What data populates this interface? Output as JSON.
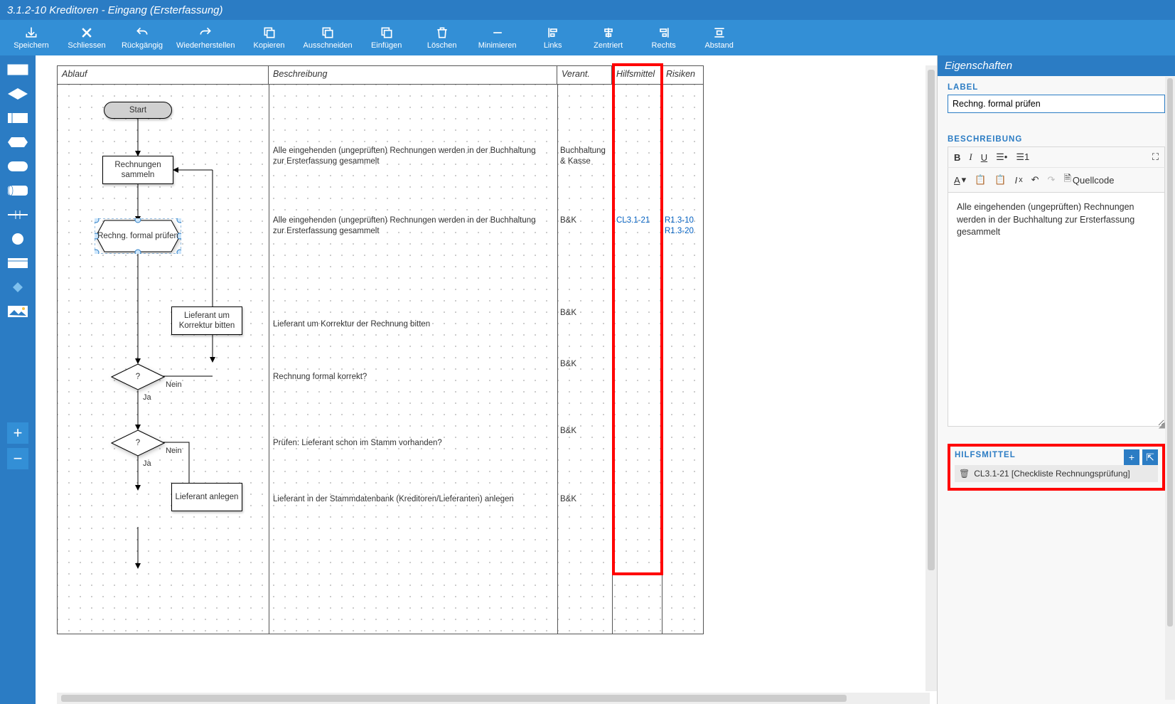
{
  "title": "3.1.2-10 Kreditoren - Eingang (Ersterfassung)",
  "toolbar": {
    "save": "Speichern",
    "close": "Schliessen",
    "undo": "Rückgängig",
    "redo": "Wiederherstellen",
    "copy": "Kopieren",
    "cut": "Ausschneiden",
    "paste": "Einfügen",
    "delete": "Löschen",
    "minimize": "Minimieren",
    "alignLeft": "Links",
    "alignCenter": "Zentriert",
    "alignRight": "Rechts",
    "spacing": "Abstand"
  },
  "swimlanes": {
    "ablauf": "Ablauf",
    "beschreibung": "Beschreibung",
    "verant": "Verant.",
    "hilfsmittel": "Hilfsmittel",
    "risiken": "Risiken"
  },
  "nodes": {
    "start": "Start",
    "n1": "Rechnungen sammeln",
    "n2": "Rechng. formal prüfen",
    "n3": "Lieferant um Korrektur bitten",
    "d1": "?",
    "d2": "?",
    "n4": "Lieferant anlegen",
    "ja": "Ja",
    "nein": "Nein"
  },
  "rows": {
    "r1": {
      "desc": "Alle eingehenden (ungeprüften) Rechnungen werden in der Buchhaltung zur Ersterfassung gesammelt",
      "verant": "Buchhaltung & Kasse"
    },
    "r2": {
      "desc": "Alle eingehenden (ungeprüften) Rechnungen werden in der Buchhaltung zur Ersterfassung gesammelt",
      "verant": "B&K",
      "hilfs": "CL3.1-21",
      "risk1": "R1.3-10",
      "risk2": "R1.3-20"
    },
    "r3": {
      "desc": "Lieferant um Korrektur der Rechnung bitten",
      "verant": "B&K"
    },
    "r4": {
      "desc": "Rechnung formal korrekt?",
      "verant": "B&K"
    },
    "r5": {
      "desc": "Prüfen: Lieferant schon im Stamm vorhanden?",
      "verant": "B&K"
    },
    "r6": {
      "desc": "Lieferant in der Stammdatenbank (Kreditoren/Lieferanten) anlegen",
      "verant": "B&K"
    }
  },
  "rightPanel": {
    "header": "Eigenschaften",
    "labelSection": "LABEL",
    "labelValue": "Rechng. formal prüfen",
    "descSection": "BESCHREIBUNG",
    "sourceBtn": "Quellcode",
    "descText": "Alle eingehenden (ungeprüften) Rechnungen werden in der Buchhaltung zur Ersterfassung gesammelt",
    "hilfsSection": "HILFSMITTEL",
    "hilfsItem": "CL3.1-21 [Checkliste Rechnungsprüfung]"
  }
}
